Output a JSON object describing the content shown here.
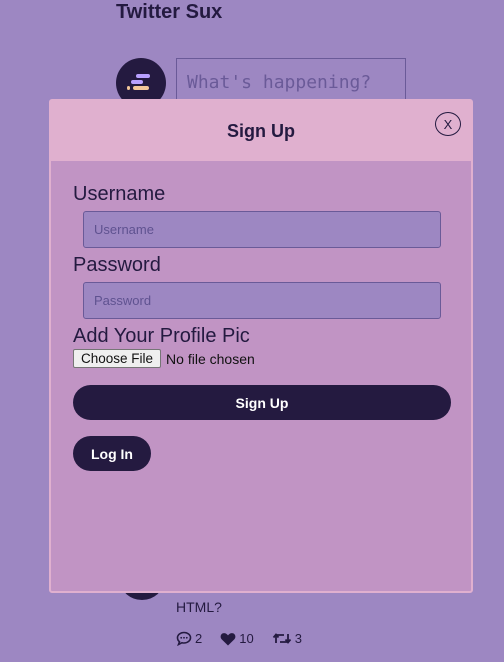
{
  "app": {
    "title": "Twitter Sux"
  },
  "compose": {
    "placeholder": "What's happening?"
  },
  "tweet": {
    "text": "HTML?",
    "replies": "2",
    "likes": "10",
    "retweets": "3"
  },
  "modal": {
    "title": "Sign Up",
    "close_label": "X",
    "username_label": "Username",
    "username_placeholder": "Username",
    "password_label": "Password",
    "password_placeholder": "Password",
    "pic_label": "Add Your Profile Pic",
    "file_button": "Choose File",
    "file_status": "No file chosen",
    "submit_label": "Sign Up",
    "login_label": "Log In"
  },
  "colors": {
    "background": "#9d87c2",
    "accent_dark": "#241a40",
    "modal_body": "#c194c4",
    "modal_header": "#e0b0cf"
  },
  "icons": [
    "logo-icon",
    "reply-icon",
    "heart-icon",
    "retweet-icon"
  ]
}
